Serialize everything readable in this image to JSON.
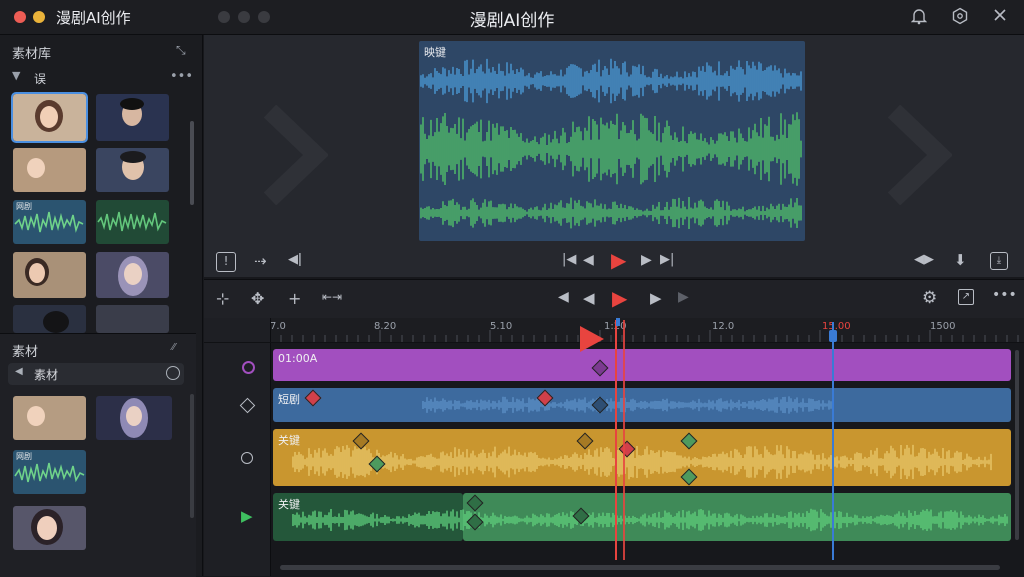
{
  "window": {
    "app_name": "漫剧AI创作",
    "title": "漫剧AI创作"
  },
  "sidebar": {
    "library_title": "素材库",
    "filter_label": "误",
    "assets_title": "素材",
    "assets_dropdown": "素材",
    "waveform_thumb_label": "网剧",
    "waveform_thumb_label_2": "网剧"
  },
  "preview": {
    "video_label": "映键"
  },
  "timeline": {
    "ruler_labels": [
      "7.0",
      "8.20",
      "5.10",
      "1:20",
      "12.0",
      "15.00",
      "1500"
    ],
    "tracks": [
      {
        "label": "01:00A",
        "color": "#a24fbf"
      },
      {
        "label": "短剧",
        "color": "#3d6a9e"
      },
      {
        "label": "关键",
        "color": "#c9962f"
      },
      {
        "label": "关键",
        "color": "#3f8a58"
      }
    ]
  },
  "colors": {
    "accent_red": "#e8443f",
    "playhead_blue": "#3a7bd5"
  }
}
